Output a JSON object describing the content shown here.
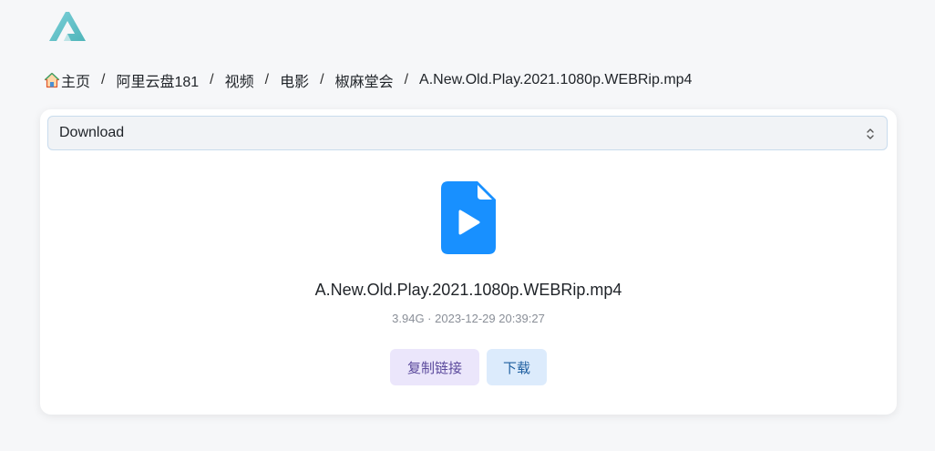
{
  "header": {
    "logo_icon": "alist-logo"
  },
  "breadcrumb": {
    "home_icon": "home-icon",
    "items": [
      {
        "label": "主页"
      },
      {
        "label": "阿里云盘181"
      },
      {
        "label": "视频"
      },
      {
        "label": "电影"
      },
      {
        "label": "椒麻堂会"
      },
      {
        "label": "A.New.Old.Play.2021.1080p.WEBRip.mp4"
      }
    ],
    "separator": "/"
  },
  "preview_select": {
    "selected": "Download",
    "caret_icon": "chevron-up-down-icon"
  },
  "file": {
    "icon": "video-file-icon",
    "icon_color": "#1890ff",
    "name": "A.New.Old.Play.2021.1080p.WEBRip.mp4",
    "meta": "3.94G · 2023-12-29 20:39:27"
  },
  "actions": {
    "copy_link_label": "复制链接",
    "download_label": "下载"
  }
}
